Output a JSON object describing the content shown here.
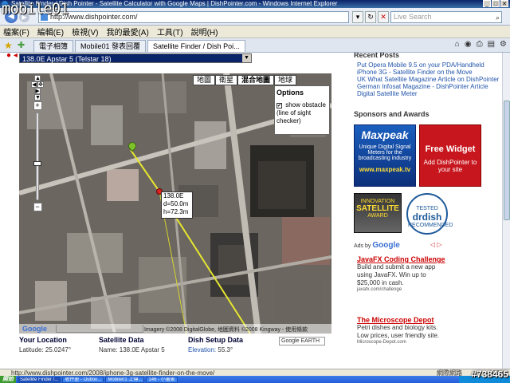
{
  "window": {
    "title": "Satellite Finder / Dish Pointer - Satellite Calculator with Google Maps | DishPointer.com - Windows Internet Explorer",
    "watermark_left": "mobile01",
    "watermark_right": "#738465"
  },
  "address": {
    "url": "http://www.dishpointer.com/",
    "search_placeholder": "Live Search"
  },
  "menu": [
    "檔案(F)",
    "編輯(E)",
    "檢視(V)",
    "我的最愛(A)",
    "工具(T)",
    "說明(H)"
  ],
  "tabs": [
    {
      "label": "電子相簿"
    },
    {
      "label": "Mobile01 發表回覆"
    },
    {
      "label": "Satellite Finder / Dish Poi..."
    }
  ],
  "page": {
    "satellite_select": "138.0E Apstar 5 (Telstar 18)",
    "map_types": [
      "地圖",
      "衛星",
      "混合地圖",
      "地球"
    ],
    "options": {
      "title": "Options",
      "checkbox_label": "show obstacle (line of sight checker)",
      "checked": true
    },
    "info_bubble": [
      "138.0E",
      "d=50.0m",
      "h=72.3m"
    ],
    "map_footer": "Imagery ©2008 DigitalGlobe, 地圖資料 ©2008 Kingway - 使用條款",
    "google_earth_label": "Google EARTH",
    "data": {
      "location_heading": "Your Location",
      "location_value": "Latitude: 25.0247°",
      "satellite_heading": "Satellite Data",
      "satellite_value": "Name: 138.0E Apstar 5",
      "dish_heading": "Dish Setup Data",
      "dish_label": "Elevation:",
      "dish_value": "55.3°"
    }
  },
  "right": {
    "recent_heading": "Recent Posts",
    "recent_posts": [
      "Put Opera Mobile 9.5 on your PDA/Handheld",
      "iPhone 3G - Satellite Finder on the Move",
      "UK What Satellite Magazine Article on DishPointer",
      "German Infosat Magazine - DishPointer Article",
      "Digital Satellite Meter"
    ],
    "sponsors_heading": "Sponsors and Awards",
    "ad1": {
      "brand": "Maxpeak",
      "tagline": "Unique Digital Signal Meters for the broadcasting industry",
      "url": "www.maxpeak.tv"
    },
    "ad2": {
      "title": "Free Widget",
      "body": "Add DishPointer to your site"
    },
    "badge1": {
      "top": "INNOVATION",
      "main": "SATELLITE",
      "bottom": "AWARD"
    },
    "badge2": {
      "top": "TESTED",
      "main": "drdish",
      "bottom": "RECOMMENDED"
    },
    "ads_by": "Ads by",
    "ads_google": "Google",
    "text_ads": [
      {
        "title": "JavaFX Coding Challenge",
        "body": "Build and submit a new app using JavaFX. Win up to $25,000 in cash.",
        "url": "javafx.com/challenge"
      },
      {
        "title": "The Microscope Depot",
        "body": "Petri dishes and biology kits. Low prices, user friendly site.",
        "url": "Microscope-Depot.com"
      }
    ]
  },
  "status": {
    "text": "http://www.dishpointer.com/2008/iphone-3g-satellite-finder-on-the-move/",
    "zone": "網際網路",
    "zoom": "100%"
  },
  "taskbar": {
    "start": "開始",
    "items": [
      "Satellite Finder /...",
      "收件匣 - Outloo...",
      "Mobile01 上傳...",
      "146 - 小畫家"
    ]
  }
}
